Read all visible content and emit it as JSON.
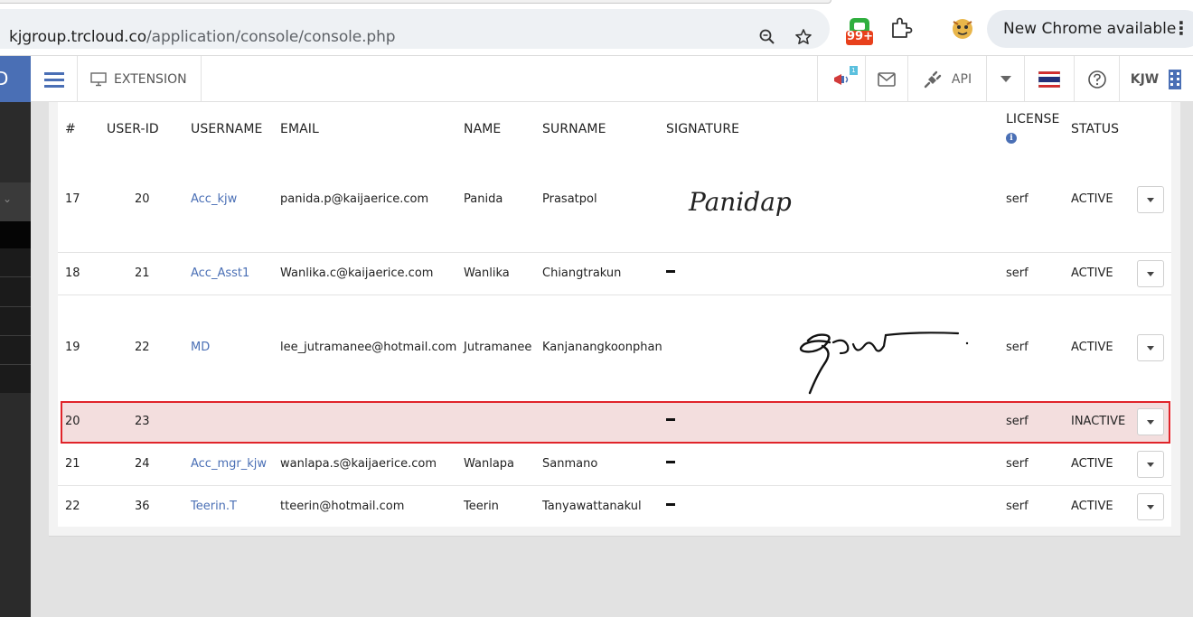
{
  "browser": {
    "url_host": "kjgroup.trcloud.co",
    "url_path": "/application/console/console.php",
    "badge_count": "99+",
    "update_label": "New Chrome available",
    "menu_dots": "⋮"
  },
  "nav": {
    "logo_letter": "D",
    "extension_label": "EXTENSION",
    "notification_badge": "1",
    "api_label": "API",
    "user_label": "KJW"
  },
  "table": {
    "headers": {
      "num": "#",
      "user_id": "USER-ID",
      "username": "USERNAME",
      "email": "EMAIL",
      "name": "NAME",
      "surname": "SURNAME",
      "signature": "SIGNATURE",
      "license": "LICENSE",
      "status": "STATUS"
    },
    "signature_text_17": "Panidap",
    "rows": [
      {
        "num": "17",
        "user_id": "20",
        "username": "Acc_kjw",
        "email": "panida.p@kaijaerice.com",
        "name": "Panida",
        "surname": "Prasatpol",
        "signature": "image",
        "license": "serf",
        "status": "ACTIVE"
      },
      {
        "num": "18",
        "user_id": "21",
        "username": "Acc_Asst1",
        "email": "Wanlika.c@kaijaerice.com",
        "name": "Wanlika",
        "surname": "Chiangtrakun",
        "signature": "-",
        "license": "serf",
        "status": "ACTIVE"
      },
      {
        "num": "19",
        "user_id": "22",
        "username": "MD",
        "email": "lee_jutramanee@hotmail.com",
        "name": "Jutramanee",
        "surname": "Kanjanangkoonphan",
        "signature": "image",
        "license": "serf",
        "status": "ACTIVE"
      },
      {
        "num": "20",
        "user_id": "23",
        "username": "",
        "email": "",
        "name": "",
        "surname": "",
        "signature": "-",
        "license": "serf",
        "status": "INACTIVE"
      },
      {
        "num": "21",
        "user_id": "24",
        "username": "Acc_mgr_kjw",
        "email": "wanlapa.s@kaijaerice.com",
        "name": "Wanlapa",
        "surname": "Sanmano",
        "signature": "-",
        "license": "serf",
        "status": "ACTIVE"
      },
      {
        "num": "22",
        "user_id": "36",
        "username": "Teerin.T",
        "email": "tteerin@hotmail.com",
        "name": "Teerin",
        "surname": "Tanyawattanakul",
        "signature": "-",
        "license": "serf",
        "status": "ACTIVE"
      }
    ]
  },
  "icons": {
    "zoom": "magnifier-icon",
    "bookmark": "star-icon",
    "extensions": "puzzle-icon",
    "info": "info-icon"
  },
  "colors": {
    "brand": "#4a6fb5",
    "inactive_row_bg": "#f3dede",
    "inactive_row_border": "#e0242a"
  }
}
